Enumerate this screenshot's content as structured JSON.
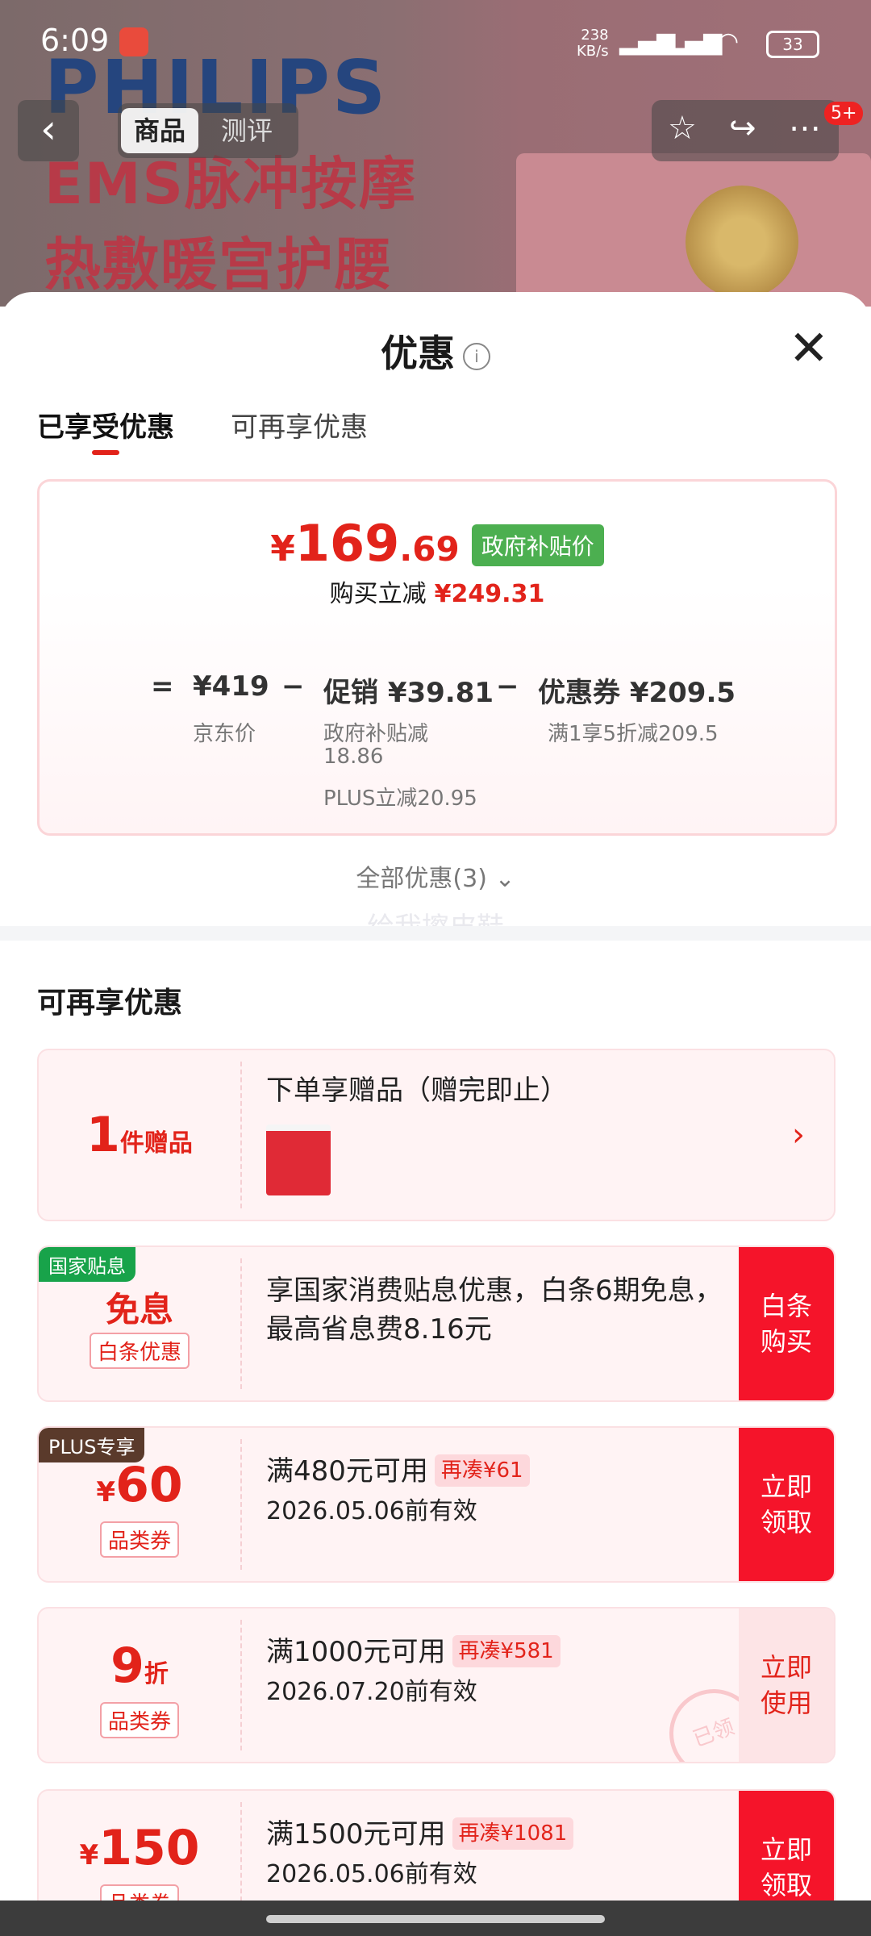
{
  "status_bar": {
    "time": "6:09",
    "net_speed_top": "238",
    "net_speed_bottom": "KB/s",
    "battery": "33"
  },
  "background": {
    "brand": "PHILIPS",
    "slogan_line1": "EMS脉冲按摩",
    "slogan_line2": "热敷暖宫护腰"
  },
  "nav": {
    "tab_product": "商品",
    "tab_review": "测评",
    "badge": "5+"
  },
  "sheet": {
    "title": "优惠",
    "tabs": [
      "已享受优惠",
      "可再享优惠"
    ],
    "summary": {
      "price_symbol": "¥",
      "price_int": "169",
      "price_dec": ".69",
      "price_badge": "政府补贴价",
      "save_label": "购买立减",
      "save_value": "¥249.31",
      "eq": "=",
      "jd_price": "¥419",
      "jd_price_label": "京东价",
      "minus": "−",
      "promo": "促销 ¥39.81",
      "promo_sub1": "政府补贴减",
      "promo_sub2": "18.86",
      "promo_sub3": "PLUS立减20.95",
      "coupon": "优惠券 ¥209.5",
      "coupon_sub": "满1享5折减209.5"
    },
    "all_offers": "全部优惠(3)",
    "watermark": "给我擦皮鞋",
    "section_title": "可再享优惠",
    "cards": [
      {
        "left_big": "1",
        "left_unit": "件赠品",
        "text": "下单享赠品（赠完即止）"
      },
      {
        "corner": "国家贴息",
        "left_big": "免息",
        "left_tag": "白条优惠",
        "text": "享国家消费贴息优惠，白条6期免息，最高省息费8.16元",
        "cta": "白条\n购买"
      },
      {
        "corner": "PLUS专享",
        "left_symbol": "¥",
        "left_big": "60",
        "left_tag": "品类券",
        "line1": "满480元可用",
        "chip": "再凑¥61",
        "line2": "2026.05.06前有效",
        "cta": "立即\n领取"
      },
      {
        "left_big": "9",
        "left_unit": "折",
        "left_tag": "品类券",
        "line1": "满1000元可用",
        "chip": "再凑¥581",
        "line2": "2026.07.20前有效",
        "cta": "立即\n使用",
        "stamp": "已领"
      },
      {
        "left_symbol": "¥",
        "left_big": "150",
        "left_tag": "品类券",
        "line1": "满1500元可用",
        "chip": "再凑¥1081",
        "line2": "2026.05.06前有效",
        "cta": "立即\n领取"
      }
    ]
  }
}
